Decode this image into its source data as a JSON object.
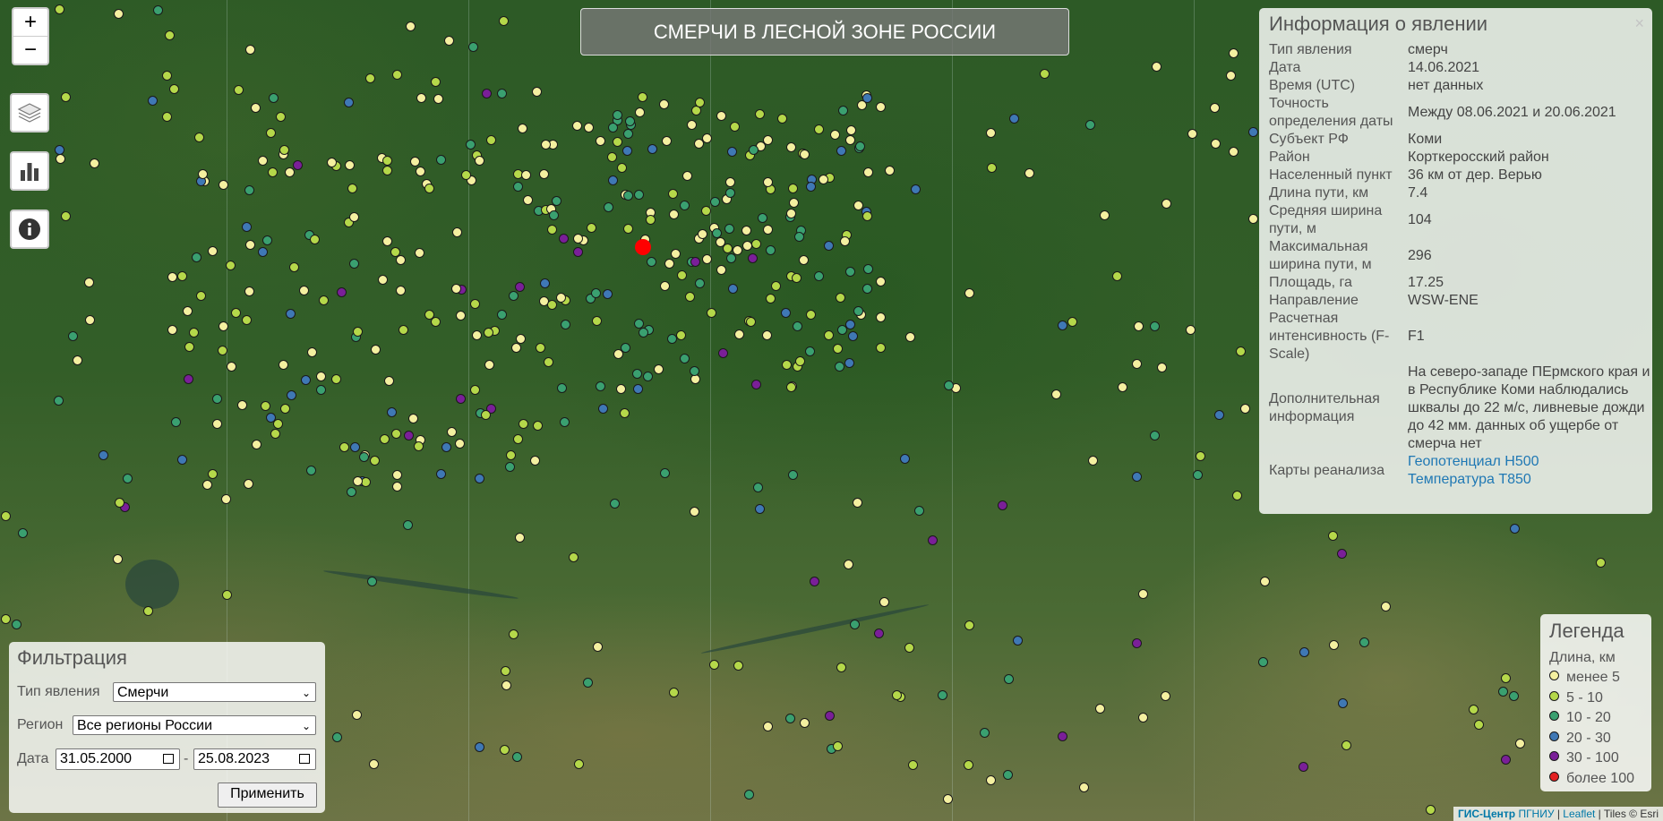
{
  "title": "СМЕРЧИ В ЛЕСНОЙ ЗОНЕ РОССИИ",
  "zoom": {
    "in_label": "+",
    "out_label": "−"
  },
  "colors": {
    "lt5": "#f4f0a0",
    "5to10": "#b5d84a",
    "10to20": "#3aa070",
    "20to30": "#3f78b5",
    "30to100": "#7a1f98",
    "gt100": "#e32222"
  },
  "info": {
    "title": "Информация о явлении",
    "close": "×",
    "rows": [
      {
        "key": "Тип явления",
        "value": "смерч"
      },
      {
        "key": "Дата",
        "value": "14.06.2021"
      },
      {
        "key": "Время (UTC)",
        "value": "нет данных"
      },
      {
        "key": "Точность определения даты",
        "value": "Между 08.06.2021 и 20.06.2021"
      },
      {
        "key": "Субъект РФ",
        "value": "Коми"
      },
      {
        "key": "Район",
        "value": "Корткеросский район"
      },
      {
        "key": "Населенный пункт",
        "value": "36 км от дер. Верью"
      },
      {
        "key": "Длина пути, км",
        "value": "7.4"
      },
      {
        "key": "Средняя ширина пути, м",
        "value": "104"
      },
      {
        "key": "Максимальная ширина пути, м",
        "value": "296"
      },
      {
        "key": "Площадь, га",
        "value": "17.25"
      },
      {
        "key": "Направление",
        "value": "WSW-ENE"
      },
      {
        "key": "Расчетная интенсивность (F-Scale)",
        "value": "F1"
      },
      {
        "key": "Дополнительная информация",
        "value": "На северо-западе ПЕрмского края и в Республике Коми наблюдались шквалы до 22 м/с, ливневые дожди до 42 мм. данных об ущербе от смерча нет"
      },
      {
        "key": "Карты реанализа",
        "links": [
          "Геопотенциал Н500",
          "Температура Т850"
        ]
      }
    ]
  },
  "filter": {
    "title": "Фильтрация",
    "type_label": "Тип явления",
    "type_value": "Смерчи",
    "region_label": "Регион",
    "region_value": "Все регионы России",
    "date_label": "Дата",
    "date_from": "31.05.2000",
    "date_sep": "-",
    "date_to": "25.08.2023",
    "apply_label": "Применить"
  },
  "legend": {
    "title": "Легенда",
    "subtitle": "Длина, км",
    "items": [
      {
        "label": "менее 5",
        "color": "#f4f0a0"
      },
      {
        "label": "5 - 10",
        "color": "#b5d84a"
      },
      {
        "label": "10 - 20",
        "color": "#3aa070"
      },
      {
        "label": "20 - 30",
        "color": "#3f78b5"
      },
      {
        "label": "30 - 100",
        "color": "#7a1f98"
      },
      {
        "label": "более 100",
        "color": "#e32222"
      }
    ]
  },
  "attribution": {
    "gis": "ГИС-Центр",
    "university": "ПГНИУ",
    "leaflet": "Leaflet",
    "tiles": "Tiles © Esri",
    "sep": "|"
  }
}
